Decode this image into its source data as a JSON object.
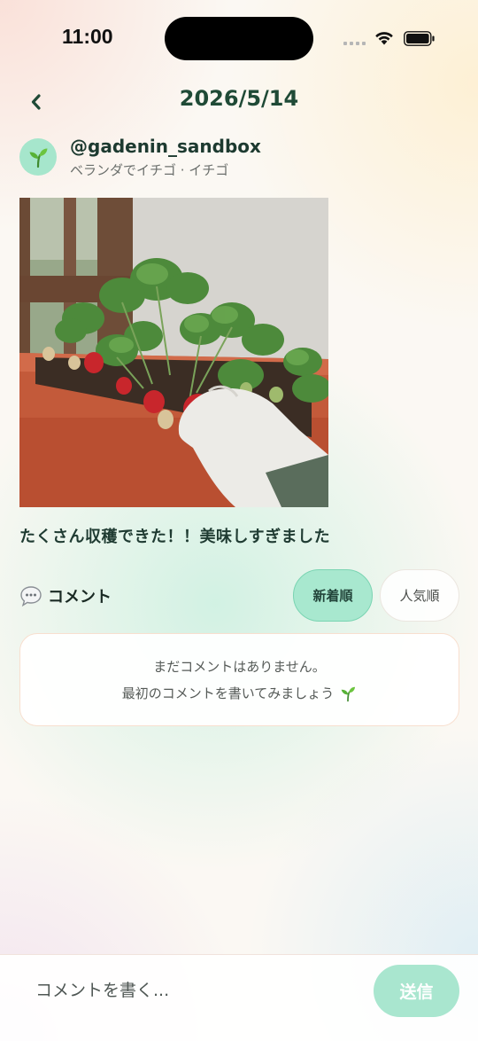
{
  "status_bar": {
    "time": "11:00"
  },
  "header": {
    "title": "2026/5/14"
  },
  "post": {
    "username": "@gadenin_sandbox",
    "subtitle": "ベランダでイチゴ · イチゴ",
    "caption": "たくさん収穫できた！！美味しすぎました",
    "photo_alt": "strawberry-planter-photo"
  },
  "comments": {
    "heading": "コメント",
    "sort_options": [
      "新着順",
      "人気順"
    ],
    "selected_sort": "新着順",
    "empty_line1": "まだコメントはありません。",
    "empty_line2": "最初のコメントを書いてみましょう"
  },
  "composer": {
    "placeholder": "コメントを書く...",
    "send_label": "送信"
  },
  "colors": {
    "accent": "#a8e8cf",
    "title": "#1f4a36",
    "text": "#1f3b32"
  }
}
